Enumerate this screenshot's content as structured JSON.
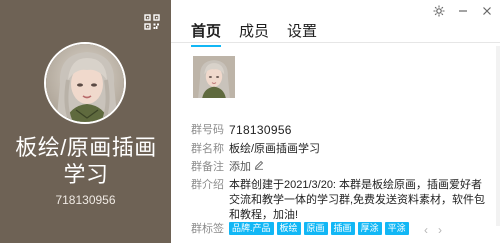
{
  "group": {
    "name": "板绘/原画插画学习",
    "id": "718130956"
  },
  "tabs": [
    {
      "label": "首页"
    },
    {
      "label": "成员"
    },
    {
      "label": "设置"
    }
  ],
  "info": {
    "id_label": "群号码",
    "id_value": "718130956",
    "name_label": "群名称",
    "name_value": "板绘/原画插画学习",
    "remark_label": "群备注",
    "remark_value": "添加",
    "intro_label": "群介绍",
    "intro_value": "本群创建于2021/3/20: 本群是板绘原画，插画爱好者交流和教学一体的学习群,免费发送资料素材，软件包和教程，加油!",
    "tags_label": "群标签",
    "tags": [
      "品牌.产品",
      "板绘",
      "原画",
      "插画",
      "厚涂",
      "平涂"
    ]
  },
  "pager": {
    "prev": "‹",
    "next": "›"
  },
  "icons": {
    "qr": "qr-code-icon",
    "settings": "gear-icon",
    "minimize": "minimize-icon",
    "close": "close-icon",
    "edit": "pencil-icon"
  },
  "colors": {
    "left_bg": "#6e6255",
    "accent": "#12b7f5"
  }
}
